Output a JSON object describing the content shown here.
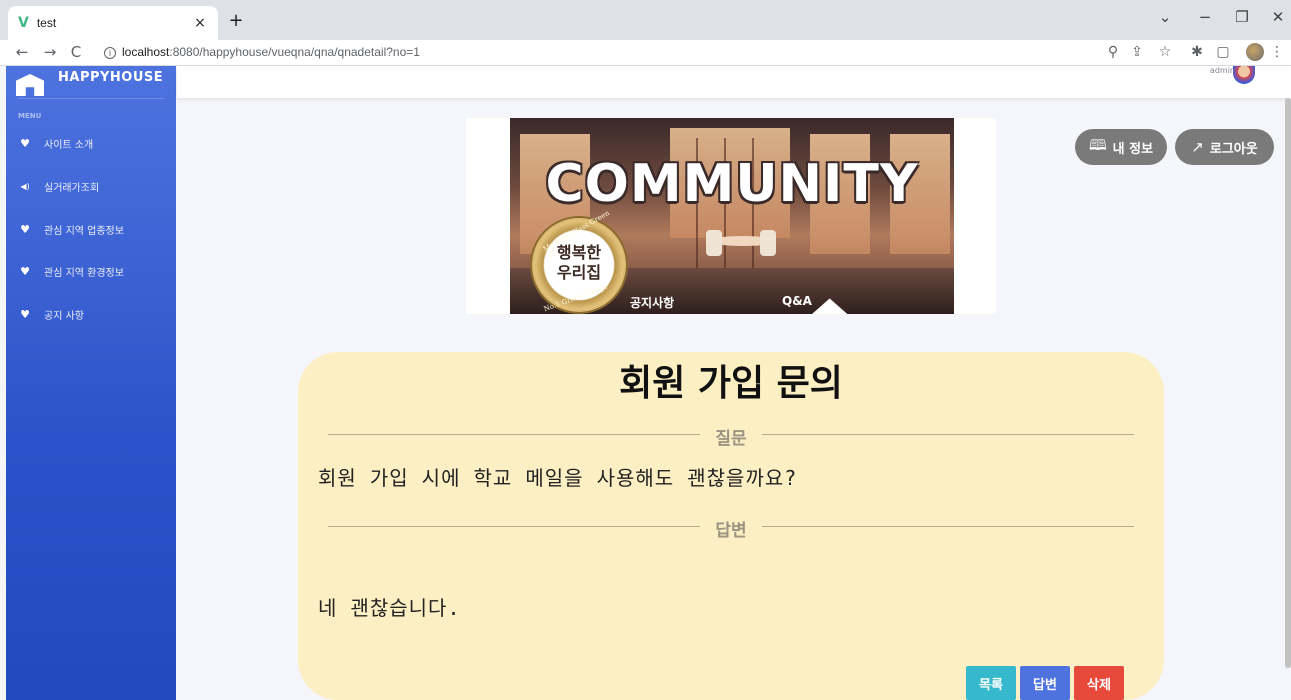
{
  "browser": {
    "tab_title": "test",
    "tab_favicon": "V",
    "tab_close": "×",
    "new_tab": "+",
    "url_host": "localhost",
    "url_path": ":8080/happyhouse/vueqna/qna/qnadetail?no=1",
    "win_minimize": "−",
    "win_restore": "❐",
    "win_close": "✕",
    "win_dropdown": "⌄",
    "back": "←",
    "forward": "→",
    "reload": "C",
    "info": "i",
    "zoom": "⚲",
    "share": "⇪",
    "star": "☆",
    "extensions": "✱",
    "sidepanel": "▢",
    "menu": "⋮"
  },
  "sidebar": {
    "brand": "HAPPYHOUSE",
    "heading": "MENU",
    "items": [
      {
        "label": "사이트 소개",
        "icon": "♥"
      },
      {
        "label": "실거래가조회",
        "icon": "◀)"
      },
      {
        "label": "관심 지역 업종정보",
        "icon": "♥"
      },
      {
        "label": "관심 지역 환경정보",
        "icon": "♥"
      },
      {
        "label": "공지 사항",
        "icon": "♥"
      }
    ]
  },
  "topbar": {
    "user_name": "admin"
  },
  "banner": {
    "title": "COMMUNITY",
    "seal_line1": "행복한",
    "seal_line2": "우리집",
    "seal_ring_top": "My First Class Green Village",
    "seal_ring_bottom": "No.1 Green Village",
    "nav_notice": "공지사항",
    "nav_qna": "Q&A"
  },
  "actions": {
    "my_info": "내 정보",
    "my_info_icon": "🕮",
    "logout": "로그아웃",
    "logout_icon": "↗"
  },
  "qna": {
    "title": "회원 가입 문의",
    "question_label": "질문",
    "question": "회원 가입 시에 학교 메일을 사용해도 괜찮을까요?",
    "answer_label": "답변",
    "answer": "네 괜찮습니다.",
    "btn_list": "목록",
    "btn_answer": "답변",
    "btn_delete": "삭제"
  },
  "colors": {
    "sidebar": "#4e73df",
    "card": "#fcefc4",
    "btn_list": "#36b9cc",
    "btn_answer": "#4e73df",
    "btn_delete": "#e74a3b"
  }
}
